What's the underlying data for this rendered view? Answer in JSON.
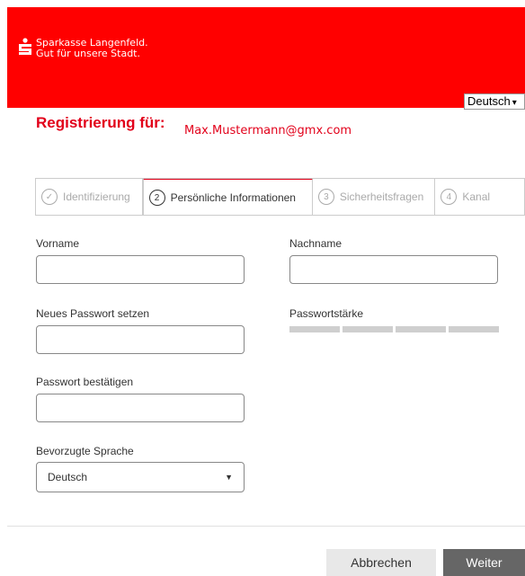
{
  "header": {
    "brand_line1": "Sparkasse Langenfeld.",
    "brand_line2": "Gut für unsere Stadt.",
    "language": "Deutsch",
    "brand_color": "#ff0000"
  },
  "registration": {
    "title": "Registrierung für:",
    "email": "Max.Mustermann@gmx.com"
  },
  "steps": [
    {
      "num": "✓",
      "label": "Identifizierung",
      "state": "done"
    },
    {
      "num": "2",
      "label": "Persönliche Informationen",
      "state": "active"
    },
    {
      "num": "3",
      "label": "Sicherheitsfragen",
      "state": "pending"
    },
    {
      "num": "4",
      "label": "Kanal",
      "state": "pending"
    }
  ],
  "form": {
    "first_name_label": "Vorname",
    "last_name_label": "Nachname",
    "new_password_label": "Neues Passwort setzen",
    "password_strength_label": "Passwortstärke",
    "confirm_password_label": "Passwort bestätigen",
    "preferred_language_label": "Bevorzugte Sprache",
    "preferred_language_value": "Deutsch"
  },
  "buttons": {
    "cancel": "Abbrechen",
    "next": "Weiter"
  }
}
